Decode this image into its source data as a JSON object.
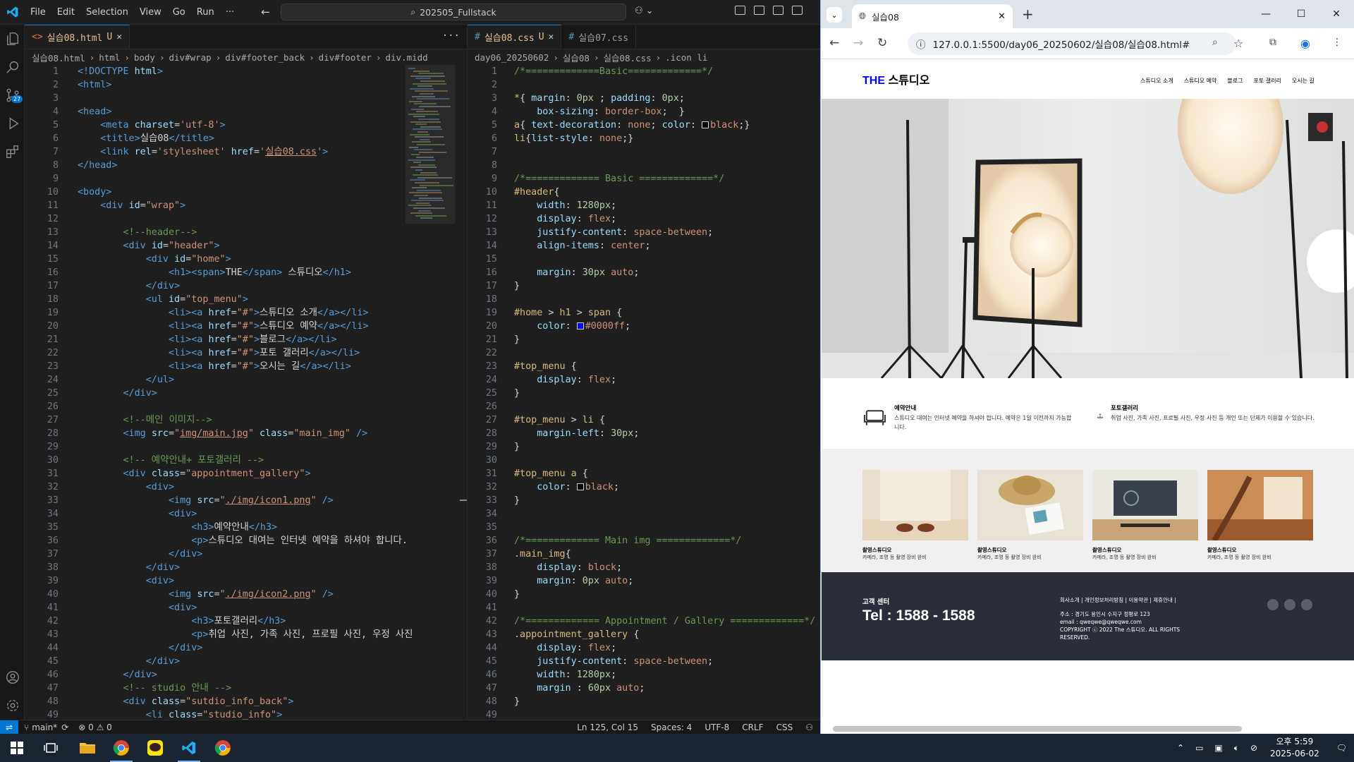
{
  "vscode": {
    "menu": [
      "File",
      "Edit",
      "Selection",
      "View",
      "Go",
      "Run",
      "···"
    ],
    "command_center": "202505_Fullstack",
    "scm_badge": "27",
    "editor1": {
      "tabs": [
        {
          "label": "실습08.html",
          "status": "U",
          "active": true
        }
      ],
      "breadcrumbs": [
        "실습08.html",
        "html",
        "body",
        "div#wrap",
        "div#footer_back",
        "div#footer",
        "div.midd"
      ],
      "lines": [
        {
          "n": "1",
          "html": "<span class='tg'>&lt;!DOCTYPE</span> <span class='at'>html</span><span class='tg'>&gt;</span>"
        },
        {
          "n": "2",
          "html": "<span class='tg'>&lt;html&gt;</span>"
        },
        {
          "n": "3",
          "html": ""
        },
        {
          "n": "4",
          "html": "<span class='tg'>&lt;head&gt;</span>"
        },
        {
          "n": "5",
          "html": "    <span class='tg'>&lt;meta</span> <span class='at'>charset</span>=<span class='st'>'utf-8'</span><span class='tg'>&gt;</span>"
        },
        {
          "n": "6",
          "html": "    <span class='tg'>&lt;title&gt;</span><span class='tx'>실습08</span><span class='tg'>&lt;/title&gt;</span>"
        },
        {
          "n": "7",
          "html": "    <span class='tg'>&lt;link</span> <span class='at'>rel</span>=<span class='st'>'stylesheet'</span> <span class='at'>href</span>=<span class='st'>'<u>실습08.css</u>'</span><span class='tg'>&gt;</span>"
        },
        {
          "n": "8",
          "html": "<span class='tg'>&lt;/head&gt;</span>"
        },
        {
          "n": "9",
          "html": ""
        },
        {
          "n": "10",
          "html": "<span class='tg'>&lt;body&gt;</span>"
        },
        {
          "n": "11",
          "html": "    <span class='tg'>&lt;div</span> <span class='at'>id</span>=<span class='st'>\"wrap\"</span><span class='tg'>&gt;</span>"
        },
        {
          "n": "12",
          "html": ""
        },
        {
          "n": "13",
          "html": "        <span class='cm'>&lt;!--header--&gt;</span>"
        },
        {
          "n": "14",
          "html": "        <span class='tg'>&lt;div</span> <span class='at'>id</span>=<span class='st'>\"header\"</span><span class='tg'>&gt;</span>"
        },
        {
          "n": "15",
          "html": "            <span class='tg'>&lt;div</span> <span class='at'>id</span>=<span class='st'>\"home\"</span><span class='tg'>&gt;</span>"
        },
        {
          "n": "16",
          "html": "                <span class='tg'>&lt;h1&gt;&lt;span&gt;</span><span class='tx'>THE</span><span class='tg'>&lt;/span&gt;</span> <span class='tx'>스튜디오</span><span class='tg'>&lt;/h1&gt;</span>"
        },
        {
          "n": "17",
          "html": "            <span class='tg'>&lt;/div&gt;</span>"
        },
        {
          "n": "18",
          "html": "            <span class='tg'>&lt;ul</span> <span class='at'>id</span>=<span class='st'>\"top_menu\"</span><span class='tg'>&gt;</span>"
        },
        {
          "n": "19",
          "html": "                <span class='tg'>&lt;li&gt;&lt;a</span> <span class='at'>href</span>=<span class='st'>\"#\"</span><span class='tg'>&gt;</span><span class='tx'>스튜디오 소개</span><span class='tg'>&lt;/a&gt;&lt;/li&gt;</span>"
        },
        {
          "n": "20",
          "html": "                <span class='tg'>&lt;li&gt;&lt;a</span> <span class='at'>href</span>=<span class='st'>\"#\"</span><span class='tg'>&gt;</span><span class='tx'>스튜디오 예약</span><span class='tg'>&lt;/a&gt;&lt;/li&gt;</span>"
        },
        {
          "n": "21",
          "html": "                <span class='tg'>&lt;li&gt;&lt;a</span> <span class='at'>href</span>=<span class='st'>\"#\"</span><span class='tg'>&gt;</span><span class='tx'>블로그</span><span class='tg'>&lt;/a&gt;&lt;/li&gt;</span>"
        },
        {
          "n": "22",
          "html": "                <span class='tg'>&lt;li&gt;&lt;a</span> <span class='at'>href</span>=<span class='st'>\"#\"</span><span class='tg'>&gt;</span><span class='tx'>포토 갤러리</span><span class='tg'>&lt;/a&gt;&lt;/li&gt;</span>"
        },
        {
          "n": "23",
          "html": "                <span class='tg'>&lt;li&gt;&lt;a</span> <span class='at'>href</span>=<span class='st'>\"#\"</span><span class='tg'>&gt;</span><span class='tx'>오시는 길</span><span class='tg'>&lt;/a&gt;&lt;/li&gt;</span>"
        },
        {
          "n": "24",
          "html": "            <span class='tg'>&lt;/ul&gt;</span>"
        },
        {
          "n": "25",
          "html": "        <span class='tg'>&lt;/div&gt;</span>"
        },
        {
          "n": "26",
          "html": ""
        },
        {
          "n": "27",
          "html": "        <span class='cm'>&lt;!--메인 이미지--&gt;</span>"
        },
        {
          "n": "28",
          "html": "        <span class='tg'>&lt;img</span> <span class='at'>src</span>=<span class='st'>\"<u>img/main.jpg</u>\"</span> <span class='at'>class</span>=<span class='st'>\"main_img\"</span> <span class='tg'>/&gt;</span>"
        },
        {
          "n": "29",
          "html": ""
        },
        {
          "n": "30",
          "html": "        <span class='cm'>&lt;!-- 예약안내+ 포토갤러리 --&gt;</span>"
        },
        {
          "n": "31",
          "html": "        <span class='tg'>&lt;div</span> <span class='at'>class</span>=<span class='st'>\"appointment_gallery\"</span><span class='tg'>&gt;</span>"
        },
        {
          "n": "32",
          "html": "            <span class='tg'>&lt;div&gt;</span>"
        },
        {
          "n": "33",
          "html": "                <span class='tg'>&lt;img</span> <span class='at'>src</span>=<span class='st'>\"<u>./img/icon1.png</u>\"</span> <span class='tg'>/&gt;</span>"
        },
        {
          "n": "34",
          "html": "                <span class='tg'>&lt;div&gt;</span>"
        },
        {
          "n": "35",
          "html": "                    <span class='tg'>&lt;h3&gt;</span><span class='tx'>예약안내</span><span class='tg'>&lt;/h3&gt;</span>"
        },
        {
          "n": "36",
          "html": "                    <span class='tg'>&lt;p&gt;</span><span class='tx'>스튜디오 대여는 인터넷 예약을 하셔야 합니다.</span>"
        },
        {
          "n": "37",
          "html": "                <span class='tg'>&lt;/div&gt;</span>"
        },
        {
          "n": "38",
          "html": "            <span class='tg'>&lt;/div&gt;</span>"
        },
        {
          "n": "39",
          "html": "            <span class='tg'>&lt;div&gt;</span>"
        },
        {
          "n": "40",
          "html": "                <span class='tg'>&lt;img</span> <span class='at'>src</span>=<span class='st'>\"<u>./img/icon2.png</u>\"</span> <span class='tg'>/&gt;</span>"
        },
        {
          "n": "41",
          "html": "                <span class='tg'>&lt;div&gt;</span>"
        },
        {
          "n": "42",
          "html": "                    <span class='tg'>&lt;h3&gt;</span><span class='tx'>포토갤러리</span><span class='tg'>&lt;/h3&gt;</span>"
        },
        {
          "n": "43",
          "html": "                    <span class='tg'>&lt;p&gt;</span><span class='tx'>취업 사진, 가족 사진, 프로필 사진, 우정 사진</span>"
        },
        {
          "n": "44",
          "html": "                <span class='tg'>&lt;/div&gt;</span>"
        },
        {
          "n": "45",
          "html": "            <span class='tg'>&lt;/div&gt;</span>"
        },
        {
          "n": "46",
          "html": "        <span class='tg'>&lt;/div&gt;</span>"
        },
        {
          "n": "47",
          "html": "        <span class='cm'>&lt;!-- studio 안내 --&gt;</span>"
        },
        {
          "n": "48",
          "html": "        <span class='tg'>&lt;div</span> <span class='at'>class</span>=<span class='st'>\"sutdio_info_back\"</span><span class='tg'>&gt;</span>"
        },
        {
          "n": "49",
          "html": "            <span class='tg'>&lt;li</span> <span class='at'>class</span>=<span class='st'>\"studio_info\"</span><span class='tg'>&gt;</span>"
        }
      ]
    },
    "editor2": {
      "tabs": [
        {
          "label": "실습08.css",
          "status": "U",
          "active": true
        },
        {
          "label": "실습07.css",
          "status": "",
          "active": false
        }
      ],
      "breadcrumbs": [
        "day06_20250602",
        "실습08",
        "실습08.css",
        ".icon li"
      ],
      "lines": [
        {
          "n": "1",
          "html": "<span class='cm'>/*=============Basic=============*/</span>"
        },
        {
          "n": "2",
          "html": ""
        },
        {
          "n": "3",
          "html": "<span class='sel'>*</span><span class='pn'>{</span> <span class='pr'>margin</span><span class='pn'>:</span> <span class='nm'>0px</span> <span class='pn'>;</span> <span class='pr'>padding</span><span class='pn'>:</span> <span class='nm'>0px</span><span class='pn'>;</span>"
        },
        {
          "n": "4",
          "html": "    <span class='pr'>box-sizing</span><span class='pn'>:</span> <span class='vl'>border-box</span><span class='pn'>;  }</span>"
        },
        {
          "n": "5",
          "html": "<span class='sel'>a</span><span class='pn'>{</span> <span class='pr'>text-decoration</span><span class='pn'>:</span> <span class='vl'>none</span><span class='pn'>;</span> <span class='pr'>color</span><span class='pn'>:</span> <span class='swatch' style='background:#000'></span><span class='vl'>black</span><span class='pn'>;}</span>"
        },
        {
          "n": "6",
          "html": "<span class='sel'>li</span><span class='pn'>{</span><span class='pr'>list-style</span><span class='pn'>:</span> <span class='vl'>none</span><span class='pn'>;}</span>"
        },
        {
          "n": "7",
          "html": ""
        },
        {
          "n": "8",
          "html": ""
        },
        {
          "n": "9",
          "html": "<span class='cm'>/*============= Basic =============*/</span>"
        },
        {
          "n": "10",
          "html": "<span class='sel'>#header</span><span class='pn'>{</span>"
        },
        {
          "n": "11",
          "html": "    <span class='pr'>width</span><span class='pn'>:</span> <span class='nm'>1280px</span><span class='pn'>;</span>"
        },
        {
          "n": "12",
          "html": "    <span class='pr'>display</span><span class='pn'>:</span> <span class='vl'>flex</span><span class='pn'>;</span>"
        },
        {
          "n": "13",
          "html": "    <span class='pr'>justify-content</span><span class='pn'>:</span> <span class='vl'>space-between</span><span class='pn'>;</span>"
        },
        {
          "n": "14",
          "html": "    <span class='pr'>align-items</span><span class='pn'>:</span> <span class='vl'>center</span><span class='pn'>;</span>"
        },
        {
          "n": "15",
          "html": ""
        },
        {
          "n": "16",
          "html": "    <span class='pr'>margin</span><span class='pn'>:</span> <span class='nm'>30px</span> <span class='vl'>auto</span><span class='pn'>;</span>"
        },
        {
          "n": "17",
          "html": "<span class='pn'>}</span>"
        },
        {
          "n": "18",
          "html": ""
        },
        {
          "n": "19",
          "html": "<span class='sel'>#home</span> <span class='pn'>&gt;</span> <span class='sel'>h1</span> <span class='pn'>&gt;</span> <span class='sel'>span</span> <span class='pn'>{</span>"
        },
        {
          "n": "20",
          "html": "    <span class='pr'>color</span><span class='pn'>:</span> <span class='swatch' style='background:#0000ff'></span><span class='vl'>#0000ff</span><span class='pn'>;</span>"
        },
        {
          "n": "21",
          "html": "<span class='pn'>}</span>"
        },
        {
          "n": "22",
          "html": ""
        },
        {
          "n": "23",
          "html": "<span class='sel'>#top_menu</span> <span class='pn'>{</span>"
        },
        {
          "n": "24",
          "html": "    <span class='pr'>display</span><span class='pn'>:</span> <span class='vl'>flex</span><span class='pn'>;</span>"
        },
        {
          "n": "25",
          "html": "<span class='pn'>}</span>"
        },
        {
          "n": "26",
          "html": ""
        },
        {
          "n": "27",
          "html": "<span class='sel'>#top_menu</span> <span class='pn'>&gt;</span> <span class='sel'>li</span> <span class='pn'>{</span>"
        },
        {
          "n": "28",
          "html": "    <span class='pr'>margin-left</span><span class='pn'>:</span> <span class='nm'>30px</span><span class='pn'>;</span>"
        },
        {
          "n": "29",
          "html": "<span class='pn'>}</span>"
        },
        {
          "n": "30",
          "html": ""
        },
        {
          "n": "31",
          "html": "<span class='sel'>#top_menu</span> <span class='sel'>a</span> <span class='pn'>{</span>"
        },
        {
          "n": "32",
          "html": "    <span class='pr'>color</span><span class='pn'>:</span> <span class='swatch' style='background:#000'></span><span class='vl'>black</span><span class='pn'>;</span>"
        },
        {
          "n": "33",
          "html": "<span class='pn'>}</span>"
        },
        {
          "n": "34",
          "html": ""
        },
        {
          "n": "35",
          "html": ""
        },
        {
          "n": "36",
          "html": "<span class='cm'>/*============= Main img =============*/</span>"
        },
        {
          "n": "37",
          "html": "<span class='sel'>.main_img</span><span class='pn'>{</span>"
        },
        {
          "n": "38",
          "html": "    <span class='pr'>display</span><span class='pn'>:</span> <span class='vl'>block</span><span class='pn'>;</span>"
        },
        {
          "n": "39",
          "html": "    <span class='pr'>margin</span><span class='pn'>:</span> <span class='nm'>0px</span> <span class='vl'>auto</span><span class='pn'>;</span>"
        },
        {
          "n": "40",
          "html": "<span class='pn'>}</span>"
        },
        {
          "n": "41",
          "html": ""
        },
        {
          "n": "42",
          "html": "<span class='cm'>/*============= Appointment / Gallery =============*/</span>"
        },
        {
          "n": "43",
          "html": "<span class='sel'>.appointment_gallery</span> <span class='pn'>{</span>"
        },
        {
          "n": "44",
          "html": "    <span class='pr'>display</span><span class='pn'>:</span> <span class='vl'>flex</span><span class='pn'>;</span>"
        },
        {
          "n": "45",
          "html": "    <span class='pr'>justify-content</span><span class='pn'>:</span> <span class='vl'>space-between</span><span class='pn'>;</span>"
        },
        {
          "n": "46",
          "html": "    <span class='pr'>width</span><span class='pn'>:</span> <span class='nm'>1280px</span><span class='pn'>;</span>"
        },
        {
          "n": "47",
          "html": "    <span class='pr'>margin</span> <span class='pn'>:</span> <span class='nm'>60px</span> <span class='vl'>auto</span><span class='pn'>;</span>"
        },
        {
          "n": "48",
          "html": "<span class='pn'>}</span>"
        },
        {
          "n": "49",
          "html": ""
        }
      ]
    },
    "statusbar": {
      "branch": "main*",
      "problems": "⊗ 0 ⚠ 0",
      "cursor": "Ln 125, Col 15",
      "spaces": "Spaces: 4",
      "encoding": "UTF-8",
      "eol": "CRLF",
      "language": "CSS"
    }
  },
  "chrome": {
    "tab_title": "실습08",
    "url": "127.0.0.1:5500/day06_20250602/실습08/실습08.html#",
    "page": {
      "logo_the": "THE",
      "logo_rest": " 스튜디오",
      "menu": [
        "스튜디오 소개",
        "스튜디오 예약",
        "블로그",
        "포토 갤러리",
        "오시는 길"
      ],
      "appointment": {
        "title": "예약안내",
        "text": "스튜디오 대여는 인터넷 예약을 하셔야 합니다. 예약은 1일 이전까지 가능합니다."
      },
      "gallery_info": {
        "title": "포토갤러리",
        "text": "취업 사진, 가족 사진, 프로필 사진, 우정 사진 등 개인 또는 단체가 이용할 수 있습니다."
      },
      "studios": [
        {
          "title": "촬영스튜디오",
          "text": "카메라, 조명 등 촬영 장비 완비"
        },
        {
          "title": "촬영스튜디오",
          "text": "카메라, 조명 등 촬영 장비 완비"
        },
        {
          "title": "촬영스튜디오",
          "text": "카메라, 조명 등 촬영 장비 완비"
        },
        {
          "title": "촬영스튜디오",
          "text": "카메라, 조명 등 촬영 장비 완비"
        }
      ],
      "footer": {
        "cc_label": "고객 센터",
        "tel": "Tel : 1588 - 1588",
        "links": "회사소개 | 개인정보처리방침 | 이용약관 | 제휴안내 |",
        "address": "주소 : 경기도 용인시 수지구 정평로 123",
        "email": "email : qweqwe@qweqwe.com",
        "copyright": "COPYRIGHT ⓒ 2022 The 스튜디오. ALL RIGHTS RESERVED."
      }
    }
  },
  "taskbar": {
    "time": "오후 5:59",
    "date": "2025-06-02"
  },
  "colors": {
    "accent": "#0078d4",
    "logo_blue": "#0000ff",
    "footer_bg": "#2a2e3a"
  }
}
